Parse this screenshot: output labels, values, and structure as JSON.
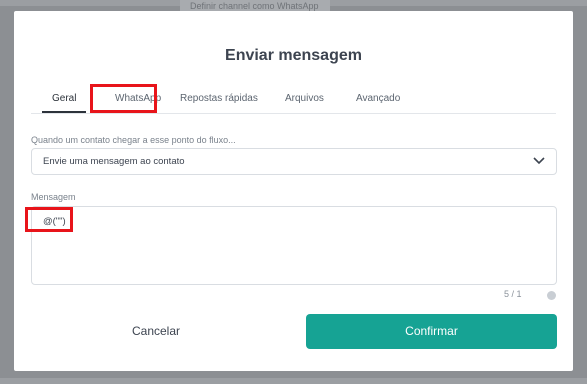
{
  "background": {
    "hint_text": "Definir channel como WhatsApp"
  },
  "modal": {
    "title": "Enviar mensagem",
    "tabs": [
      {
        "label": "Geral",
        "active": true
      },
      {
        "label": "WhatsApp",
        "active": false
      },
      {
        "label": "Repostas rápidas",
        "active": false
      },
      {
        "label": "Arquivos",
        "active": false
      },
      {
        "label": "Avançado",
        "active": false
      }
    ],
    "trigger_label": "Quando um contato chegar a esse ponto do fluxo...",
    "trigger_select": {
      "value": "Envie uma mensagem ao contato",
      "icon": "chevron-down-icon"
    },
    "message_label": "Mensagem",
    "message_value": "@(\"\")",
    "counter": "5 / 1",
    "cancel_label": "Cancelar",
    "confirm_label": "Confirmar"
  },
  "colors": {
    "overlay": "#8c8f93",
    "primary": "#16a394",
    "highlight": "#e8141a",
    "text": "#3d4450"
  }
}
